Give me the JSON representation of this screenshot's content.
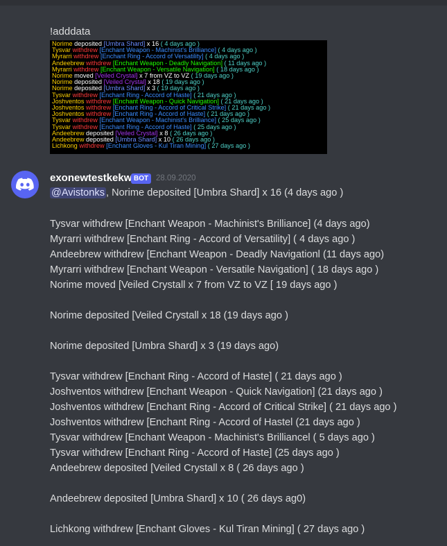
{
  "command": "!adddata",
  "colors": {
    "background": "#36393f",
    "name": "#ffd100",
    "deposited": "#ffffff",
    "withdrew": "#ff3a3a",
    "moved": "#ffffff",
    "time": "#4fd1c8",
    "bot_badge": "#5865f2",
    "mention_bg": "#4c548a"
  },
  "game_log": [
    {
      "name": "Norime",
      "action": "deposited",
      "item": "[Umbra Shard]",
      "item_color": "#6a8cff",
      "extra": " x 16",
      "time": "( 4 days ago )"
    },
    {
      "name": "Tysvar",
      "action": "withdrew",
      "item": "[Enchant Weapon - Machinist's Brilliance]",
      "item_color": "#3a8cff",
      "extra": "",
      "time": "( 4 days ago )"
    },
    {
      "name": "Myrarri",
      "action": "withdrew",
      "item": "[Enchant Ring - Accord of Versatility]",
      "item_color": "#3a8cff",
      "extra": "",
      "time": "( 4 days ago )"
    },
    {
      "name": "Andeebrew",
      "action": "withdrew",
      "item": "[Enchant Weapon - Deadly Navigation]",
      "item_color": "#1eff00",
      "extra": "",
      "time": "( 11 days ago )"
    },
    {
      "name": "Myrarri",
      "action": "withdrew",
      "item": "[Enchant Weapon - Versatile Navigation]",
      "item_color": "#1eff00",
      "extra": "",
      "time": "( 18 days ago )"
    },
    {
      "name": "Norime",
      "action": "moved",
      "item": "[Veiled Crystal]",
      "item_color": "#a335ee",
      "extra": " x 7 from VZ to VZ",
      "time": "( 19 days ago )"
    },
    {
      "name": "Norime",
      "action": "deposited",
      "item": "[Veiled Crystal]",
      "item_color": "#a335ee",
      "extra": " x 18",
      "time": "( 19 days ago )"
    },
    {
      "name": "Norime",
      "action": "deposited",
      "item": "[Umbra Shard]",
      "item_color": "#6a8cff",
      "extra": " x 3",
      "time": "( 19 days ago )"
    },
    {
      "name": "Tysvar",
      "action": "withdrew",
      "item": "[Enchant Ring - Accord of Haste]",
      "item_color": "#3a8cff",
      "extra": "",
      "time": "( 21 days ago )"
    },
    {
      "name": "Joshventos",
      "action": "withdrew",
      "item": "[Enchant Weapon - Quick Navigation]",
      "item_color": "#1eff00",
      "extra": "",
      "time": "( 21 days ago )"
    },
    {
      "name": "Joshventos",
      "action": "withdrew",
      "item": "[Enchant Ring - Accord of Critical Strike]",
      "item_color": "#3a8cff",
      "extra": "",
      "time": "( 21 days ago )"
    },
    {
      "name": "Joshventos",
      "action": "withdrew",
      "item": "[Enchant Ring - Accord of Haste]",
      "item_color": "#3a8cff",
      "extra": "",
      "time": "( 21 days ago )"
    },
    {
      "name": "Tysvar",
      "action": "withdrew",
      "item": "[Enchant Weapon - Machinist's Brilliance]",
      "item_color": "#3a8cff",
      "extra": "",
      "time": "( 25 days ago )"
    },
    {
      "name": "Tysvar",
      "action": "withdrew",
      "item": "[Enchant Ring - Accord of Haste]",
      "item_color": "#3a8cff",
      "extra": "",
      "time": "( 25 days ago )"
    },
    {
      "name": "Andeebrew",
      "action": "deposited",
      "item": "[Veiled Crystal]",
      "item_color": "#a335ee",
      "extra": " x 8",
      "time": "( 26 days ago )"
    },
    {
      "name": "Andeebrew",
      "action": "deposited",
      "item": "[Umbra Shard]",
      "item_color": "#6a8cff",
      "extra": " x 10",
      "time": "( 26 days ago )"
    },
    {
      "name": "Lichkong",
      "action": "withdrew",
      "item": "[Enchant Gloves - Kul Tiran Mining]",
      "item_color": "#3a8cff",
      "extra": "",
      "time": "( 27 days ago )"
    }
  ],
  "bot_message": {
    "username": "exonewtestkekw",
    "badge": "BOT",
    "timestamp": "28.09.2020",
    "mention": "@Avistonks",
    "first_line_rest": ", Norime deposited [Umbra Shard] x 16 (4 days ago )",
    "lines": [
      "Tysvar withdrew [Enchant Weapon - Machinist's Brilliance] (4 days ago)",
      "Myrarri withdrew [Enchant Ring - Accord of Versatility] ( 4 days ago )",
      "Andeebrew withdrew [Enchant Weapon - Deadly Navigationl (11 days ago)",
      "Myrarri withdrew [Enchant Weapon - Versatile Navigation] ( 18 days ago )",
      "Norime moved [Veiled Crystall x 7 from VZ to VZ [ 19 days ago )",
      "Norime deposited [Veiled Crystall x 18 (19 days ago )",
      "Norime deposited [Umbra Shard] x 3 (19 days ago)",
      "Tysvar withdrew [Enchant Ring - Accord of Haste] ( 21 days ago )",
      "Joshventos withdrew [Enchant Weapon - Quick Navigation] (21 days ago )",
      "Joshventos withdrew [Enchant Ring - Accord of Critical Strike] ( 21 days ago )",
      "Joshventos withdrew [Enchant Ring - Accord of Hastel (21 days ago )",
      "Tysvar withdrew [Enchant Weapon - Machinist's Brilliancel ( 5 days ago )",
      "Tysvar withdrew [Enchant Ring - Accord of Haste] (25 days ago )",
      "Andeebrew deposited [Veiled Crystall x 8 ( 26 days ago )",
      "Andeebrew deposited [Umbra Shard] x 10 ( 26 days ag0)",
      "Lichkong withdrew [Enchant Gloves - Kul Tiran Mining] ( 27 days ago )"
    ]
  }
}
